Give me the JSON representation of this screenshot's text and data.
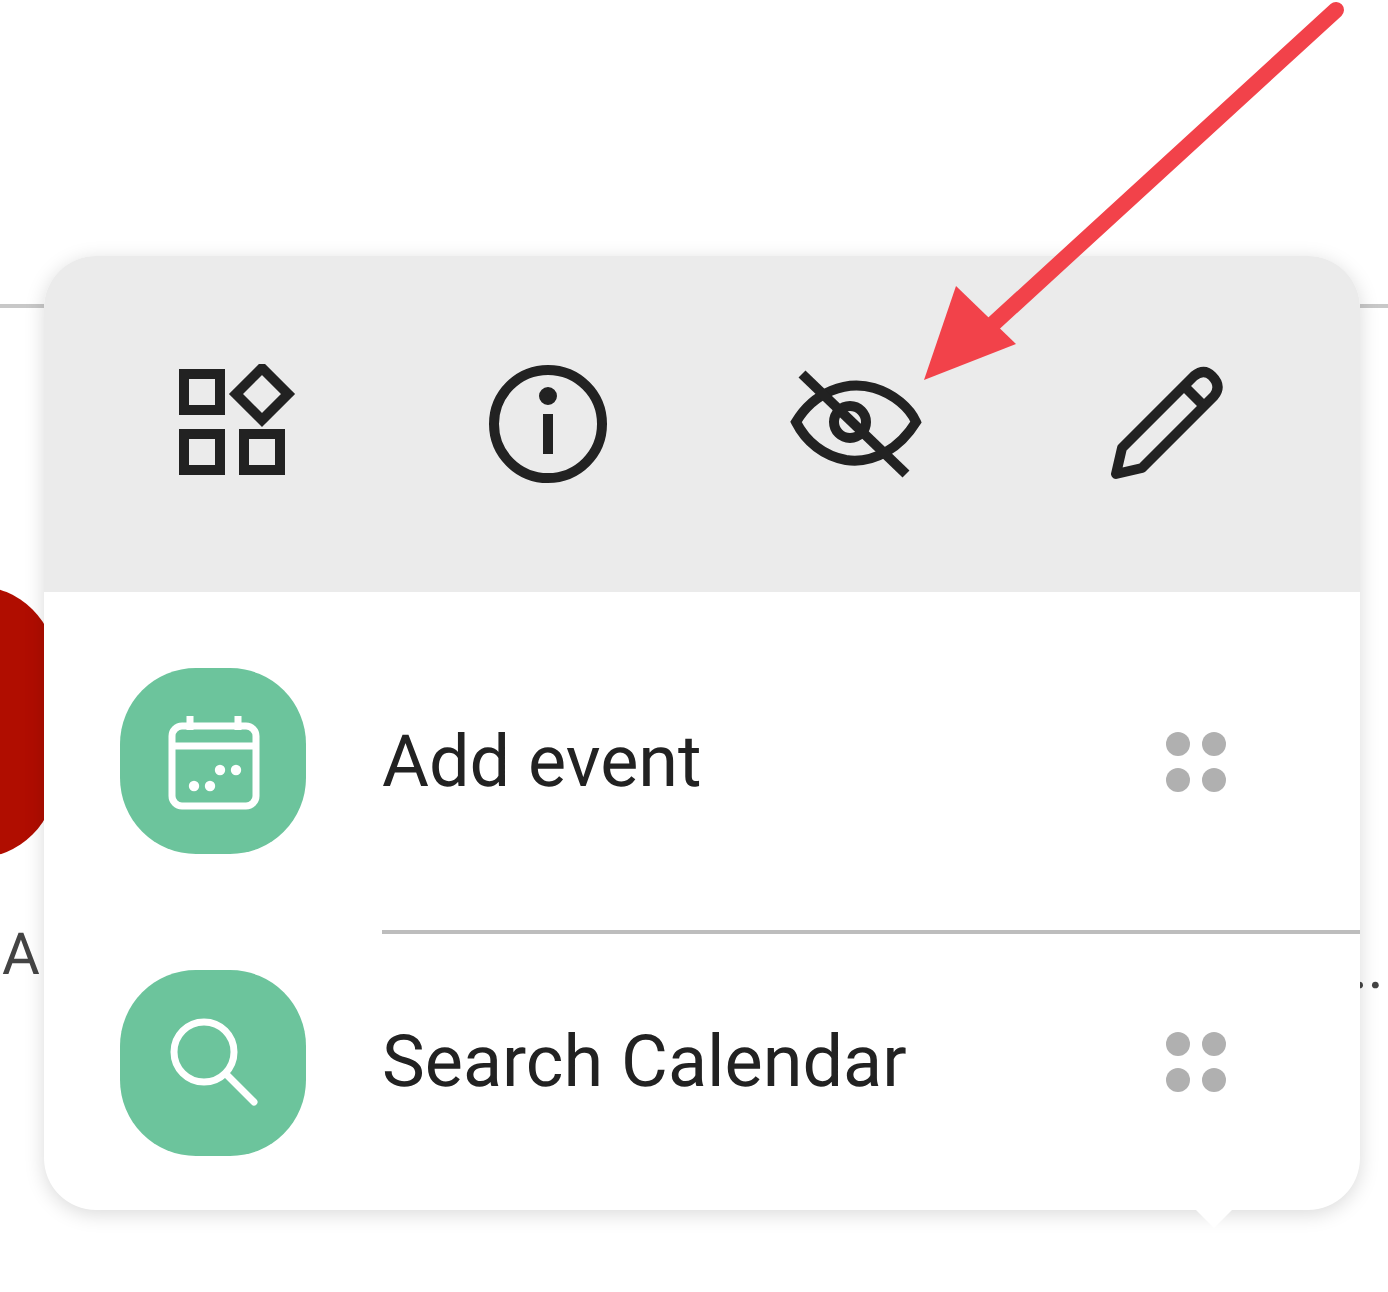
{
  "background": {
    "left_label": "A",
    "right_label": ".."
  },
  "popup": {
    "actions": [
      {
        "kind": "widgets"
      },
      {
        "kind": "info"
      },
      {
        "kind": "hide"
      },
      {
        "kind": "edit"
      }
    ],
    "shortcuts": [
      {
        "label": "Add event",
        "kind": "calendar"
      },
      {
        "label": "Search Calendar",
        "kind": "search"
      }
    ]
  },
  "annotation": {
    "kind": "arrow"
  }
}
